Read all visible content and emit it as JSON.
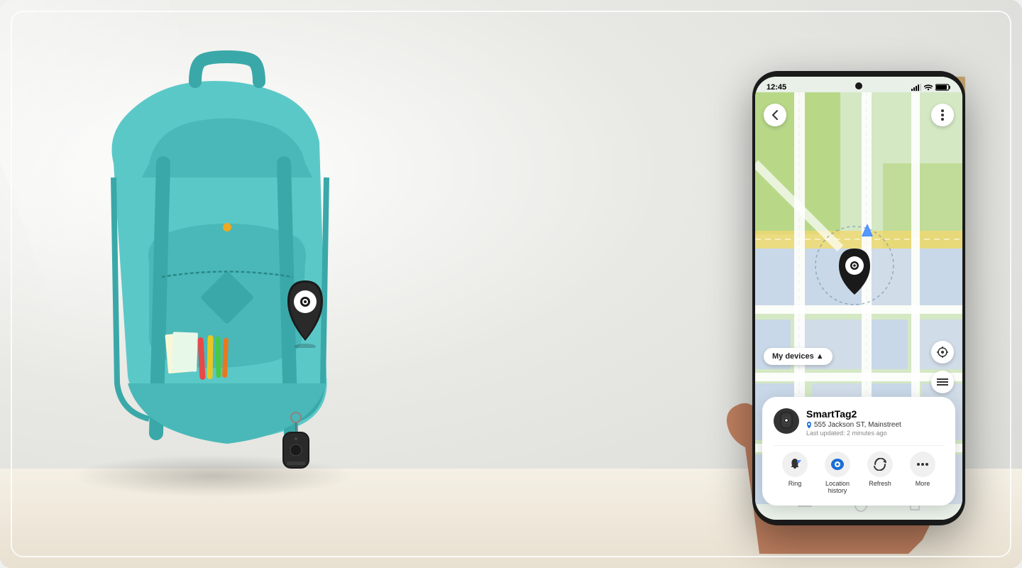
{
  "scene": {
    "background_color": "#e8e8e4",
    "outer_frame_radius": "20px"
  },
  "phone": {
    "status_bar": {
      "time": "12:45",
      "signal_icon": "signal-icon",
      "wifi_icon": "wifi-icon",
      "battery_icon": "battery-icon"
    },
    "map": {
      "back_button_label": "‹",
      "more_button_label": "⋮",
      "my_devices_label": "My devices ▲",
      "locate_button_label": "⊕",
      "list_button_label": "☰"
    },
    "device_card": {
      "device_name": "SmartTag2",
      "location": "555 Jackson ST, Mainstreet",
      "location_icon": "location-pin-icon",
      "last_updated": "Last updated: 2 minutes ago",
      "actions": [
        {
          "id": "ring",
          "label": "Ring",
          "icon": "ring-icon"
        },
        {
          "id": "location_history",
          "label": "Location\nhistory",
          "icon": "location-history-icon"
        },
        {
          "id": "refresh",
          "label": "Refresh",
          "icon": "refresh-icon"
        },
        {
          "id": "more",
          "label": "More",
          "icon": "more-icon"
        }
      ]
    },
    "nav_bar": {
      "back_indicator": "|||",
      "home_indicator": "○",
      "recents_indicator": "◻"
    }
  },
  "map_visual": {
    "background": "#d4e8c4",
    "road_color": "#ffffff",
    "block_color": "#c8d8e8",
    "park_color": "#c0dc9c"
  }
}
